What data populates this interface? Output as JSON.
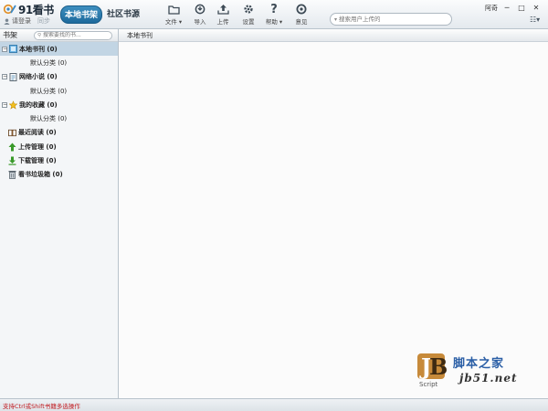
{
  "app": {
    "logo_text": "91看书",
    "login_text": "请登录",
    "sync_text": "同步"
  },
  "tabs": [
    {
      "label": "本地书架",
      "active": true
    },
    {
      "label": "社区书源",
      "active": false
    }
  ],
  "toolbar": {
    "file_label": "文件",
    "import_label": "导入",
    "upload_label": "上传",
    "settings_label": "设置",
    "help_label": "帮助",
    "feedback_label": "意见"
  },
  "search": {
    "placeholder": "搜索用户上传的"
  },
  "window": {
    "user_label": "阿奇"
  },
  "sidebar": {
    "title": "书架",
    "search_placeholder": "搜索要找的书..."
  },
  "tree": [
    {
      "label": "本地书刊 (0)",
      "expanded": true,
      "selected": true,
      "icon": "local-books-icon",
      "children": [
        "默认分类 (0)"
      ]
    },
    {
      "label": "网络小说 (0)",
      "expanded": true,
      "selected": false,
      "icon": "web-novel-icon",
      "children": [
        "默认分类 (0)"
      ]
    },
    {
      "label": "我的收藏 (0)",
      "expanded": true,
      "selected": false,
      "icon": "star-icon",
      "children": [
        "默认分类 (0)"
      ]
    },
    {
      "label": "最近阅读 (0)",
      "icon": "book-open-icon"
    },
    {
      "label": "上传管理 (0)",
      "icon": "upload-arrow-icon"
    },
    {
      "label": "下载管理 (0)",
      "icon": "download-arrow-icon"
    },
    {
      "label": "看书垃圾箱 (0)",
      "icon": "trash-icon"
    }
  ],
  "content": {
    "header": "本地书刊"
  },
  "watermark": {
    "badge_text": "Script",
    "top_text": "脚本之家",
    "bottom_text": "jb51.net"
  },
  "status": {
    "text": "支持Ctrl或Shift书籍多选操作"
  },
  "colors": {
    "accent": "#1d6a9c",
    "selected_row": "#c2d5e4",
    "status_text": "#c0181d"
  }
}
